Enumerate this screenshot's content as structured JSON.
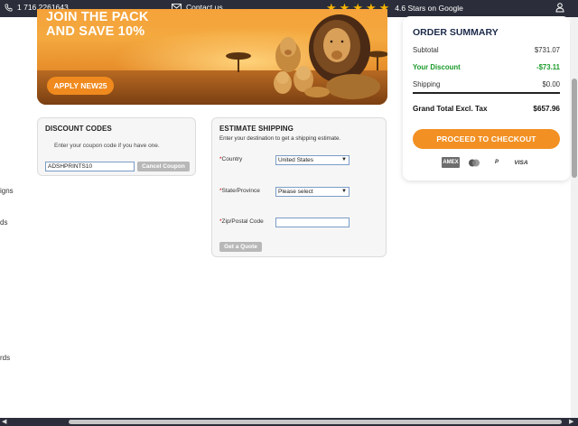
{
  "topbar": {
    "phone": "1 716 2261643",
    "contact": "Contact us",
    "rating_text": "4.6 Stars on Google",
    "stars": 5,
    "icons": [
      "phone-icon",
      "mail-icon",
      "star-icon",
      "user-icon"
    ]
  },
  "hero": {
    "headline_line1": "JOIN THE PACK",
    "headline_line2": "AND SAVE 10%",
    "cta": "APPLY NEW25"
  },
  "edge_fragments": [
    "igns",
    "ds",
    "rds"
  ],
  "discount": {
    "title": "DISCOUNT CODES",
    "hint": "Enter your coupon code if you have one.",
    "coupon_value": "ADSHPRINTS10",
    "cancel_label": "Cancel Coupon"
  },
  "shipping": {
    "title": "ESTIMATE SHIPPING",
    "subtitle": "Enter your destination to get a shipping estimate.",
    "country_label": "Country",
    "country_value": "United States",
    "state_label": "State/Province",
    "state_value": "Please select",
    "zip_label": "Zip/Postal Code",
    "zip_value": "",
    "quote_label": "Get a Quote",
    "required_mark": "*"
  },
  "summary": {
    "title": "ORDER SUMMARY",
    "subtotal_label": "Subtotal",
    "subtotal_value": "$731.07",
    "discount_label": "Your Discount",
    "discount_value": "-$73.11",
    "shipping_label": "Shipping",
    "shipping_value": "$0.00",
    "total_label": "Grand Total Excl. Tax",
    "total_value": "$657.96",
    "checkout_label": "PROCEED TO CHECKOUT",
    "payments": [
      "AMEX",
      "MC",
      "P",
      "VISA"
    ]
  },
  "colors": {
    "topbar_bg": "#2b2e3a",
    "accent_orange": "#f29023",
    "discount_green": "#1a9a2a",
    "star_gold": "#f5b400"
  }
}
